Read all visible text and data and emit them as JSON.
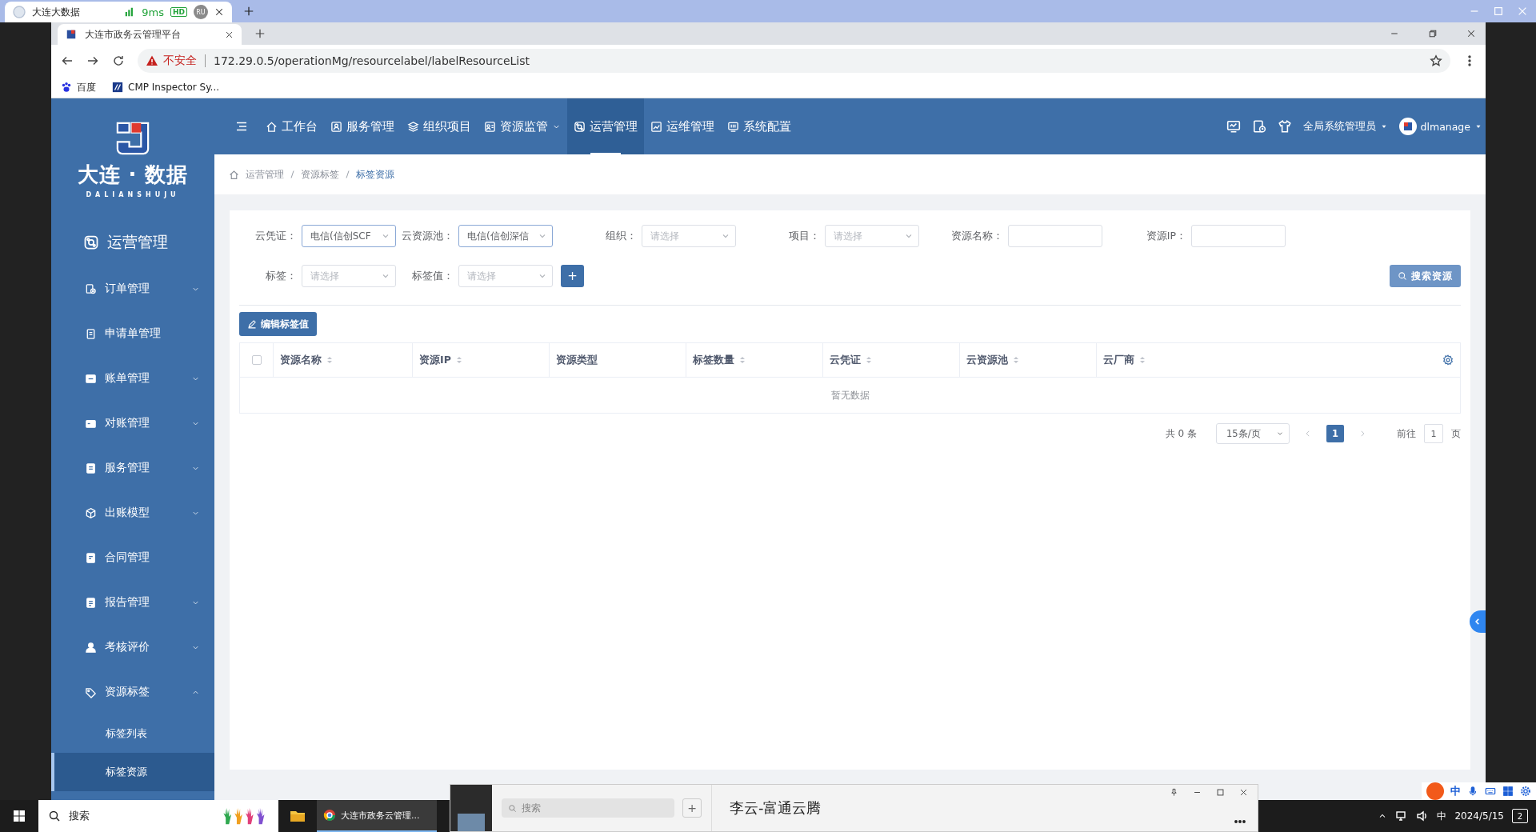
{
  "remote_tab": {
    "title": "大连大数据",
    "latency": "9ms",
    "quality": "HD",
    "user_badge": "RU"
  },
  "browser": {
    "tab_title": "大连市政务云管理平台",
    "security": "不安全",
    "url": "172.29.0.5/operationMg/resourcelabel/labelResourceList",
    "bookmarks": [
      "百度",
      "CMP Inspector Sy..."
    ]
  },
  "logo": {
    "title": "大连 · 数据",
    "subtitle": "DALIANSHUJU"
  },
  "sidebar": {
    "title": "运营管理",
    "items": [
      {
        "label": "订单管理",
        "kind": "group",
        "expanded": false
      },
      {
        "label": "申请单管理",
        "kind": "link"
      },
      {
        "label": "账单管理",
        "kind": "group",
        "expanded": false
      },
      {
        "label": "对账管理",
        "kind": "group",
        "expanded": false
      },
      {
        "label": "服务管理",
        "kind": "group",
        "expanded": false
      },
      {
        "label": "出账模型",
        "kind": "group",
        "expanded": false
      },
      {
        "label": "合同管理",
        "kind": "link"
      },
      {
        "label": "报告管理",
        "kind": "group",
        "expanded": false
      },
      {
        "label": "考核评价",
        "kind": "group",
        "expanded": false
      },
      {
        "label": "资源标签",
        "kind": "group",
        "expanded": true,
        "children": [
          {
            "label": "标签列表",
            "selected": false
          },
          {
            "label": "标签资源",
            "selected": true
          }
        ]
      }
    ]
  },
  "nav": {
    "items": [
      {
        "label": "工作台",
        "kind": "link",
        "selected": false
      },
      {
        "label": "服务管理",
        "kind": "link",
        "selected": false
      },
      {
        "label": "组织项目",
        "kind": "link",
        "selected": false
      },
      {
        "label": "资源监管",
        "kind": "menu",
        "selected": false
      },
      {
        "label": "运营管理",
        "kind": "link",
        "selected": true
      },
      {
        "label": "运维管理",
        "kind": "link",
        "selected": false
      },
      {
        "label": "系统配置",
        "kind": "link",
        "selected": false
      }
    ],
    "role": "全局系统管理员",
    "user": "dlmanage"
  },
  "breadcrumb": [
    "运营管理",
    "资源标签",
    "标签资源"
  ],
  "filters": [
    {
      "label": "云凭证：",
      "kind": "select",
      "value": "电信(信创SCF"
    },
    {
      "label": "云资源池：",
      "kind": "select",
      "value": "电信(信创深信"
    },
    {
      "label": "组织：",
      "kind": "select",
      "placeholder": "请选择"
    },
    {
      "label": "项目：",
      "kind": "select",
      "placeholder": "请选择"
    },
    {
      "label": "资源名称：",
      "kind": "input"
    },
    {
      "label": "资源IP：",
      "kind": "input"
    },
    {
      "label": "标签：",
      "kind": "select",
      "placeholder": "请选择"
    },
    {
      "label": "标签值：",
      "kind": "select",
      "placeholder": "请选择"
    }
  ],
  "add_button": "+",
  "search_button": "搜索资源",
  "edit_button": "编辑标签值",
  "table": {
    "select_all_checked": false,
    "columns": [
      {
        "label": "资源名称",
        "sortable": true
      },
      {
        "label": "资源IP",
        "sortable": true
      },
      {
        "label": "资源类型",
        "sortable": false
      },
      {
        "label": "标签数量",
        "sortable": true
      },
      {
        "label": "云凭证",
        "sortable": true
      },
      {
        "label": "云资源池",
        "sortable": true
      },
      {
        "label": "云厂商",
        "sortable": true
      }
    ],
    "empty_text": "暂无数据"
  },
  "pagination": {
    "total": "共 0 条",
    "page_size": "15条/页",
    "pages": [
      {
        "label": "1",
        "selected": true
      }
    ],
    "goto_label": "前往",
    "goto_value": "1",
    "goto_suffix": "页"
  },
  "taskbar": {
    "search_placeholder": "搜索",
    "app": "大连市政务云管理...",
    "popup_search": "搜索",
    "popup_add": "+",
    "popup_title": "李云-富通云腾",
    "ime": "中",
    "tray_lang": "中",
    "date": "2024/5/15",
    "notifications": "2"
  }
}
